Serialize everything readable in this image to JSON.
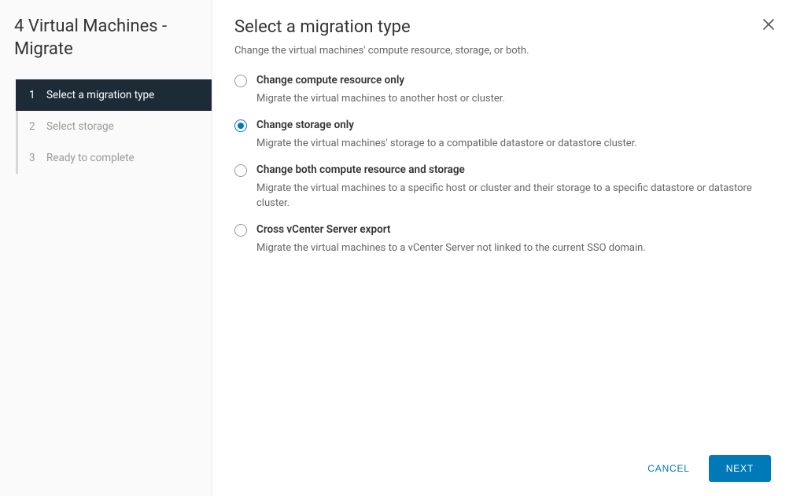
{
  "sidebar": {
    "title": "4 Virtual Machines - Migrate",
    "steps": [
      {
        "num": "1",
        "label": "Select a migration type",
        "active": true
      },
      {
        "num": "2",
        "label": "Select storage",
        "active": false
      },
      {
        "num": "3",
        "label": "Ready to complete",
        "active": false
      }
    ]
  },
  "main": {
    "title": "Select a migration type",
    "subtitle": "Change the virtual machines' compute resource, storage, or both.",
    "options": [
      {
        "label": "Change compute resource only",
        "desc": "Migrate the virtual machines to another host or cluster.",
        "selected": false
      },
      {
        "label": "Change storage only",
        "desc": "Migrate the virtual machines' storage to a compatible datastore or datastore cluster.",
        "selected": true
      },
      {
        "label": "Change both compute resource and storage",
        "desc": "Migrate the virtual machines to a specific host or cluster and their storage to a specific datastore or datastore cluster.",
        "selected": false
      },
      {
        "label": "Cross vCenter Server export",
        "desc": "Migrate the virtual machines to a vCenter Server not linked to the current SSO domain.",
        "selected": false
      }
    ]
  },
  "footer": {
    "cancel": "CANCEL",
    "next": "NEXT"
  }
}
